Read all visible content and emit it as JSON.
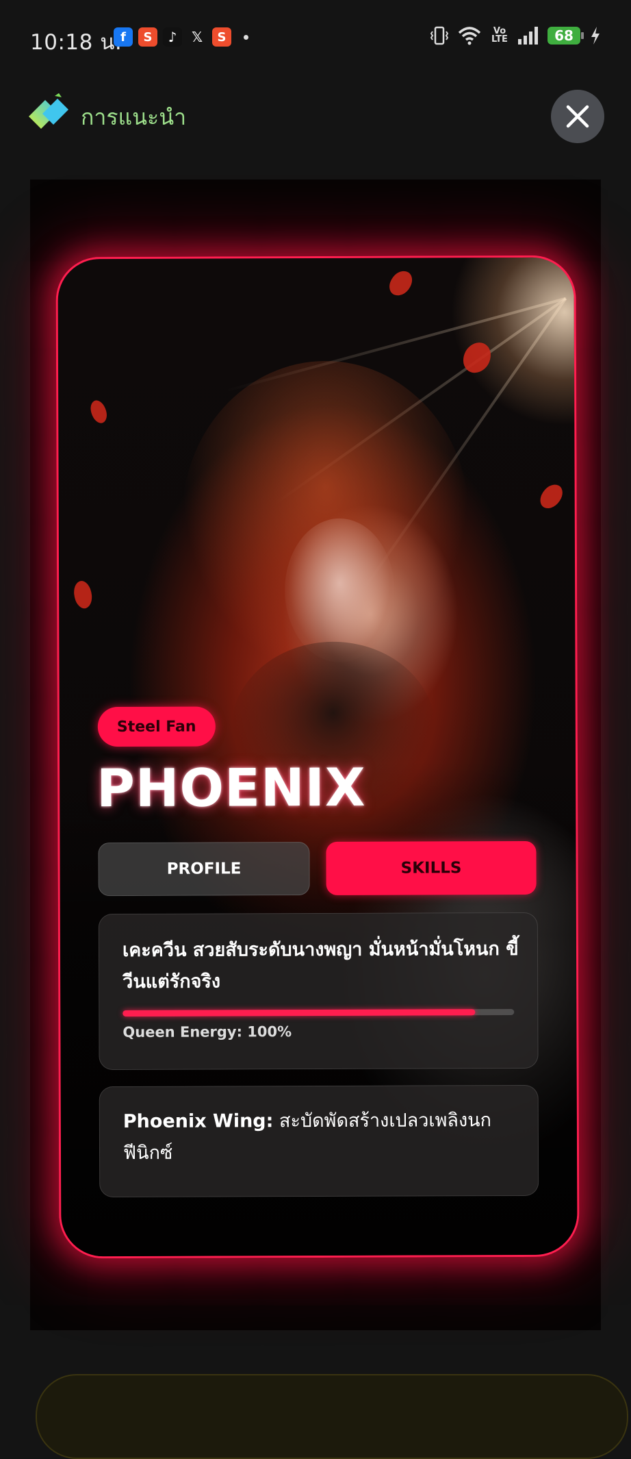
{
  "status_bar": {
    "time": "10:18 น.",
    "app_icons": [
      "facebook-icon",
      "shopee-icon",
      "tiktok-icon",
      "x-icon",
      "shopee-icon"
    ],
    "battery": "68",
    "volte": "Vo LTE"
  },
  "header": {
    "title": "การแนะนำ",
    "close_icon": "close-icon"
  },
  "card": {
    "badge": "Steel Fan",
    "name": "PHOENIX",
    "tabs": [
      {
        "label": "PROFILE",
        "active": false
      },
      {
        "label": "SKILLS",
        "active": true
      }
    ],
    "skill_description": "เคะควีน สวยสับระดับนางพญา มั่นหน้ามั่นโหนก ขี้วีนแต่รักจริง",
    "energy_label": "Queen Energy: 100%",
    "energy_level": 0.9,
    "wing_title": "Phoenix Wing:",
    "wing_text": " สะบัดพัดสร้างเปลวเพลิงนกฟีนิกซ์"
  },
  "colors": {
    "accent": "#ff1e4f",
    "badge_bg": "#ff0f47",
    "title_green": "#9ee08c",
    "background": "#141414"
  }
}
